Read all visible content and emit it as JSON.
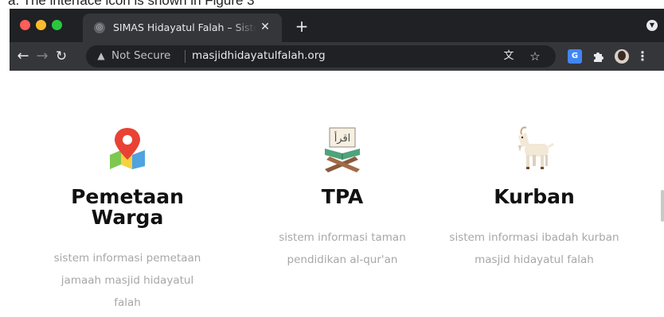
{
  "caption": "a. The interface icon is shown in Figure 3",
  "tab": {
    "title": "SIMAS Hidayatul Falah – Sistem Informasi Masjid",
    "close_glyph": "✕"
  },
  "toolbar": {
    "security_label": "Not Secure",
    "url": "masjidhidayatulfalah.org"
  },
  "features": [
    {
      "title": "Pemetaan Warga",
      "description": "sistem informasi pemetaan jamaah masjid hidayatul falah",
      "icon": "map-pin-icon"
    },
    {
      "title": "TPA",
      "description": "sistem informasi taman pendidikan al-qur'an",
      "icon": "quran-icon",
      "icon_text": "اقرأ"
    },
    {
      "title": "Kurban",
      "description": "sistem informasi ibadah kurban masjid hidayatul falah",
      "icon": "goat-icon"
    }
  ],
  "colors": {
    "frame": "#202124",
    "toolbar": "#35363a",
    "title_text": "#111111",
    "desc_text": "#a7a7a7",
    "pin_red": "#e94235"
  }
}
